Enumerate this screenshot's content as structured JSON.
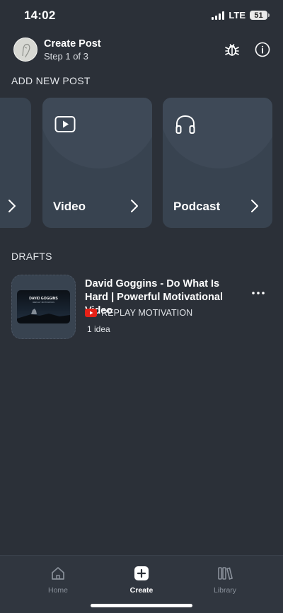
{
  "status_bar": {
    "time": "14:02",
    "network": "LTE",
    "battery": "51"
  },
  "header": {
    "title": "Create Post",
    "subtitle": "Step 1 of 3",
    "icons": [
      "bug-icon",
      "info-icon"
    ]
  },
  "add_new_post": {
    "heading": "ADD NEW POST",
    "cards": [
      {
        "label": "",
        "icon": "chevron-right-icon"
      },
      {
        "label": "Video",
        "icon": "video-play-icon"
      },
      {
        "label": "Podcast",
        "icon": "headphones-icon"
      }
    ]
  },
  "drafts": {
    "heading": "DRAFTS",
    "items": [
      {
        "title": "David Goggins - Do What Is Hard | Powerful Motivational Video",
        "source": "REPLAY MOTIVATION",
        "source_icon": "youtube-icon",
        "ideas": "1 idea",
        "thumbnail_title": "DAVID GOGGINS",
        "thumbnail_subtitle": "REPLAY MOTIVATION"
      }
    ]
  },
  "bottom_nav": {
    "items": [
      {
        "label": "Home",
        "icon": "home-icon",
        "active": false
      },
      {
        "label": "Create",
        "icon": "plus-icon",
        "active": true
      },
      {
        "label": "Library",
        "icon": "library-icon",
        "active": false
      }
    ]
  },
  "colors": {
    "background": "#2b3038",
    "card": "#384350",
    "nav": "#30363f",
    "accent": "#ffffff",
    "youtube": "#e62117"
  }
}
